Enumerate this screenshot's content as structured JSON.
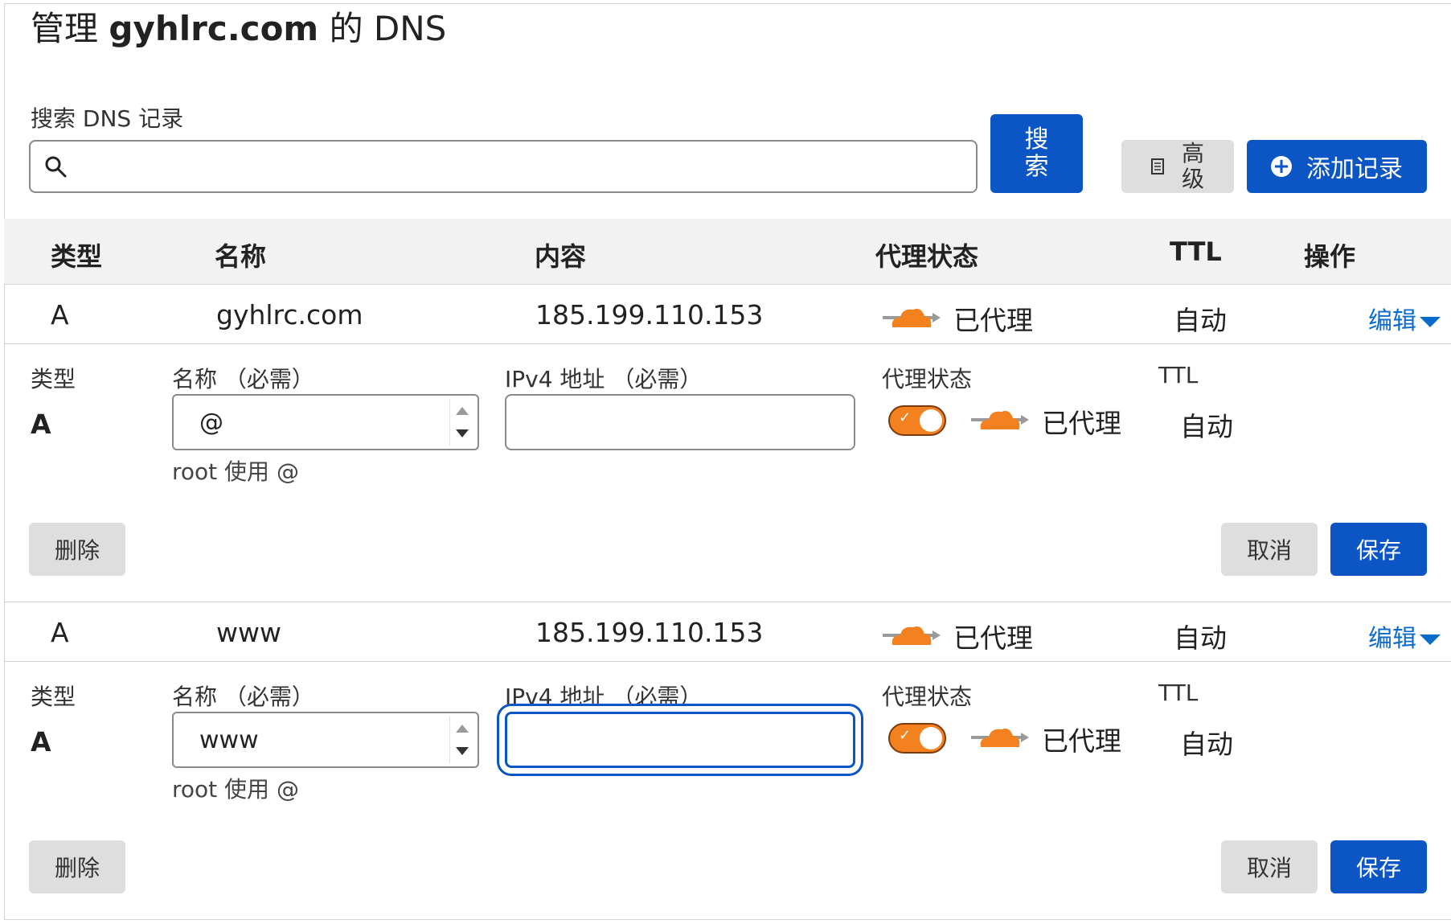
{
  "page": {
    "title_prefix": "管理",
    "title_domain": "gyhlrc.com",
    "title_suffix": "的 DNS"
  },
  "search": {
    "label": "搜索 DNS 记录",
    "value": "",
    "button_label_1": "搜",
    "button_label_2": "索"
  },
  "toolbar": {
    "advanced_1": "高",
    "advanced_2": "级",
    "add_record": "添加记录"
  },
  "table": {
    "headers": [
      "类型",
      "名称",
      "内容",
      "代理状态",
      "TTL",
      "操作"
    ],
    "rows": [
      {
        "type": "A",
        "name": "gyhlrc.com",
        "content": "185.199.110.153",
        "proxy": "已代理",
        "ttl": "自动",
        "action": "编辑",
        "editor": {
          "type_label": "类型",
          "type_value": "A",
          "name_label": "名称 （必需）",
          "name_value": "@",
          "ip_label": "IPv4 地址 （必需）",
          "ip_value": "",
          "proxy_label": "代理状态",
          "proxy_value": "已代理",
          "proxy_on": true,
          "ttl_label": "TTL",
          "ttl_value": "自动",
          "helper": "root 使用 @",
          "delete": "删除",
          "cancel": "取消",
          "save": "保存"
        }
      },
      {
        "type": "A",
        "name": "www",
        "content": "185.199.110.153",
        "proxy": "已代理",
        "ttl": "自动",
        "action": "编辑",
        "editor": {
          "type_label": "类型",
          "type_value": "A",
          "name_label": "名称 （必需）",
          "name_value": "www",
          "ip_label": "IPv4 地址 （必需）",
          "ip_value": "",
          "proxy_label": "代理状态",
          "proxy_value": "已代理",
          "proxy_on": true,
          "ttl_label": "TTL",
          "ttl_value": "自动",
          "helper": "root 使用 @",
          "delete": "删除",
          "cancel": "取消",
          "save": "保存"
        }
      }
    ]
  },
  "colors": {
    "primary": "#0b56c4",
    "proxy_orange": "#f48120",
    "link": "#0b6bcb"
  }
}
